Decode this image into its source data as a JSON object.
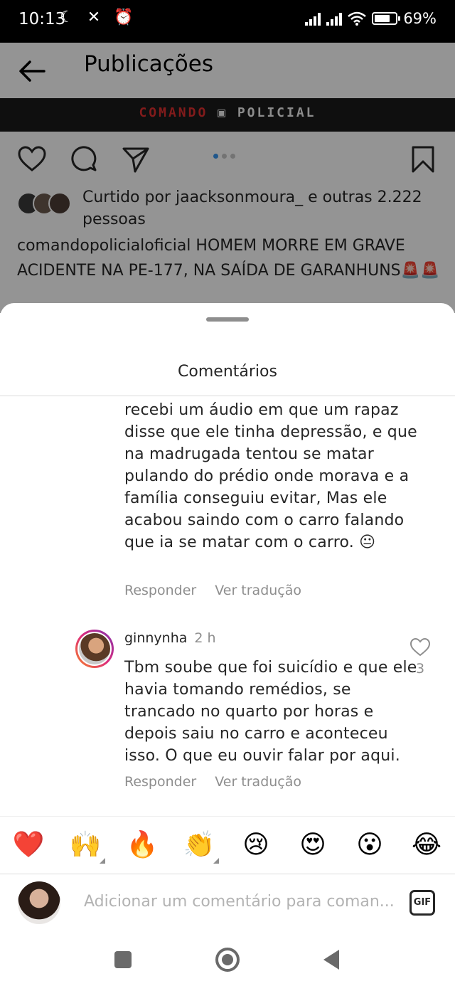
{
  "status_bar": {
    "time": "10:13",
    "left_icons": "☾ ✕ ⏰",
    "battery": "69%"
  },
  "header": {
    "title": "Publicações"
  },
  "banner": {
    "left_word": "COMANDO",
    "right_word": "POLICIAL"
  },
  "post": {
    "likes_text": "Curtido por jaacksonmoura_ e outras 2.222 pessoas",
    "caption": "comandopolicialoficial HOMEM MORRE EM GRAVE ACIDENTE NA PE-177, NA SAÍDA DE GARANHUNS🚨🚨",
    "carousel_dots": 3,
    "carousel_active": 1
  },
  "sheet": {
    "title": "Comentários"
  },
  "comments": [
    {
      "text": "recebi um áudio em que um rapaz disse que ele tinha depressão, e que na madrugada tentou se matar pulando do prédio onde morava e a família conseguiu evitar, Mas ele acabou saindo com o carro falando que ia se matar com o carro. 😐",
      "reply_label": "Responder",
      "translate_label": "Ver tradução"
    },
    {
      "username": "ginnynha",
      "time": "2 h",
      "text": "Tbm soube que foi suicídio e que ele havia tomando remédios, se trancado no quarto por horas e depois saiu no carro e aconteceu isso. O que eu ouvir falar por aqui.",
      "like_count": "3",
      "reply_label": "Responder",
      "translate_label": "Ver tradução"
    }
  ],
  "emoji_bar": [
    "❤️",
    "🙌",
    "🔥",
    "👏",
    "😢",
    "😍",
    "😮",
    "😂"
  ],
  "composer": {
    "placeholder": "Adicionar um comentário para coman...",
    "gif_label": "GIF"
  },
  "colors": {
    "accent": "#3897f0",
    "muted_text": "#8e8e8e",
    "text": "#262626",
    "banner_red": "#e03030"
  }
}
